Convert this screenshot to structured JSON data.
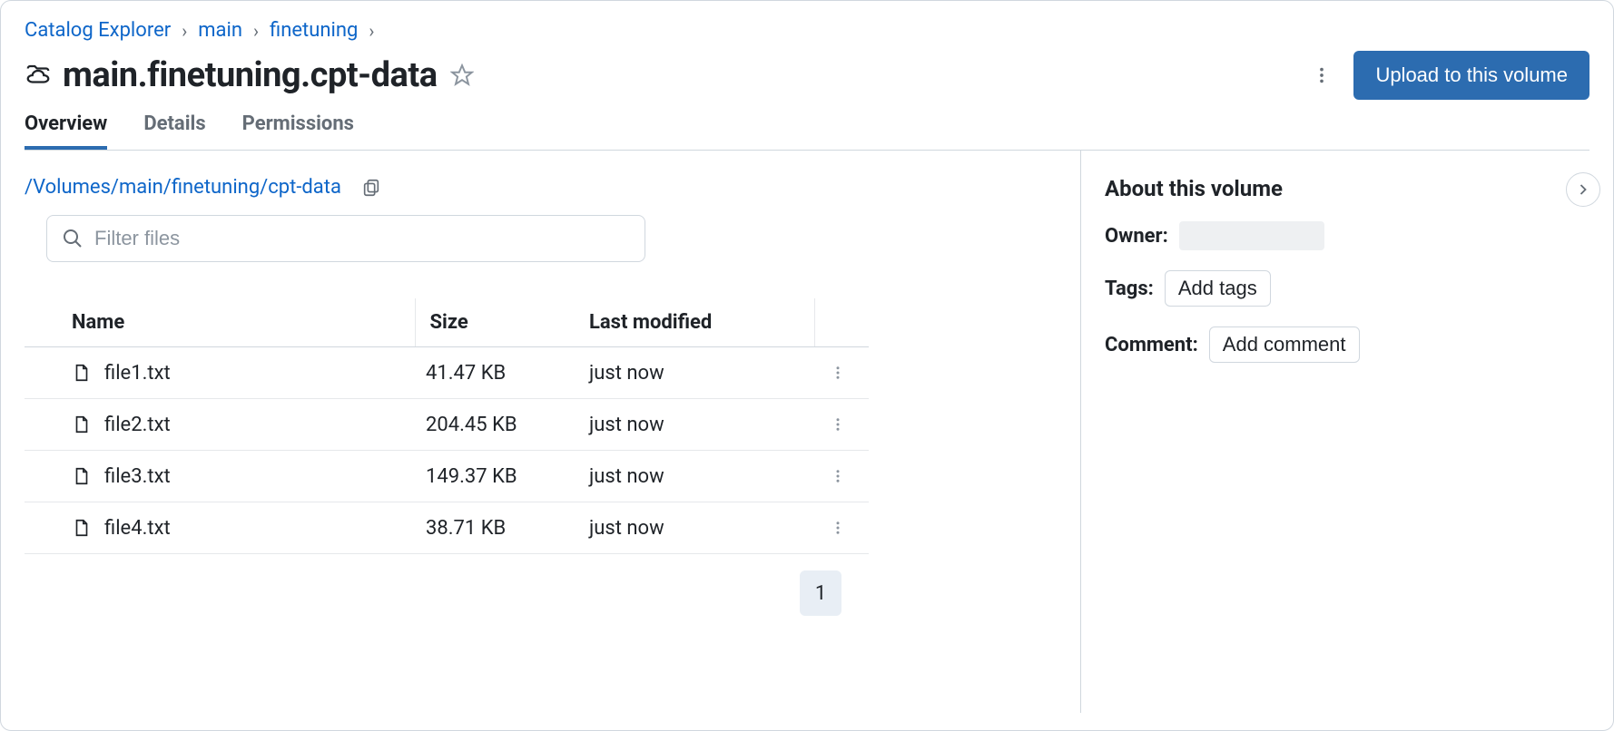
{
  "breadcrumbs": [
    {
      "label": "Catalog Explorer"
    },
    {
      "label": "main"
    },
    {
      "label": "finetuning"
    }
  ],
  "page_title": "main.finetuning.cpt-data",
  "upload_button_label": "Upload to this volume",
  "tabs": [
    {
      "label": "Overview",
      "active": true
    },
    {
      "label": "Details",
      "active": false
    },
    {
      "label": "Permissions",
      "active": false
    }
  ],
  "volume_path": "/Volumes/main/finetuning/cpt-data",
  "filter_placeholder": "Filter files",
  "table": {
    "headers": {
      "name": "Name",
      "size": "Size",
      "modified": "Last modified"
    },
    "rows": [
      {
        "name": "file1.txt",
        "size": "41.47 KB",
        "modified": "just now"
      },
      {
        "name": "file2.txt",
        "size": "204.45 KB",
        "modified": "just now"
      },
      {
        "name": "file3.txt",
        "size": "149.37 KB",
        "modified": "just now"
      },
      {
        "name": "file4.txt",
        "size": "38.71 KB",
        "modified": "just now"
      }
    ]
  },
  "pager": {
    "current": "1"
  },
  "about": {
    "title": "About this volume",
    "owner_label": "Owner:",
    "tags_label": "Tags:",
    "add_tags": "Add tags",
    "comment_label": "Comment:",
    "add_comment": "Add comment"
  }
}
